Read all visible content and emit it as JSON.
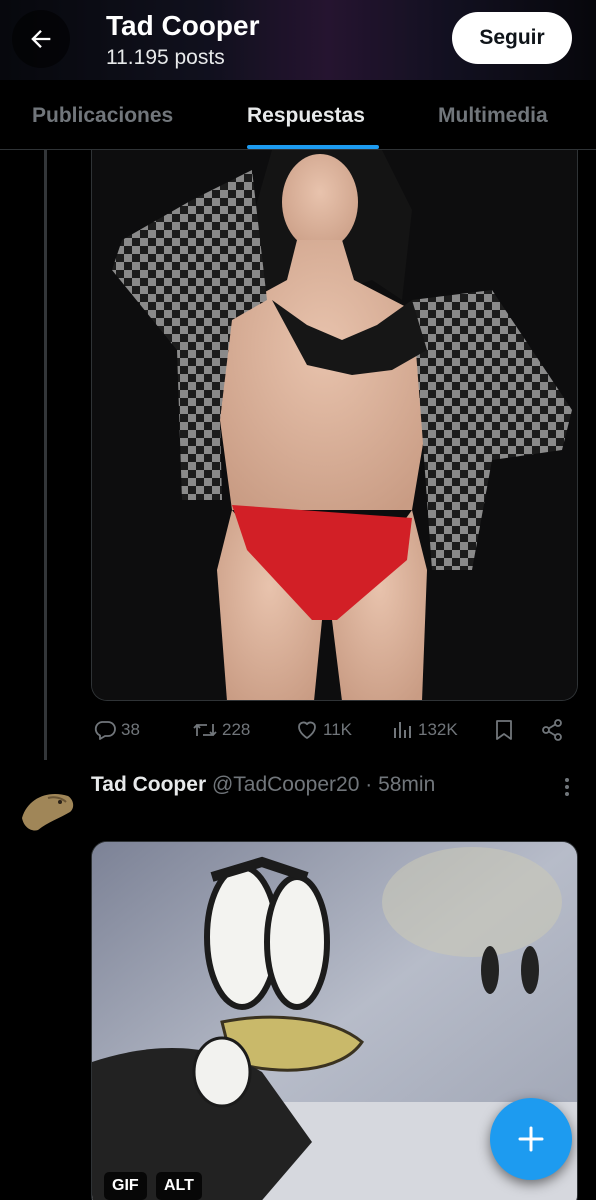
{
  "header": {
    "title": "Tad Cooper",
    "subtitle": "11.195 posts",
    "follow_label": "Seguir",
    "back_icon": "arrow-left-icon"
  },
  "tabs": [
    {
      "label": "Publicaciones",
      "active": false
    },
    {
      "label": "Respuestas",
      "active": true
    },
    {
      "label": "Multimedia",
      "active": false
    }
  ],
  "colors": {
    "accent": "#1d9bf0",
    "background": "#000000",
    "muted_text": "#71767b",
    "primary_text": "#e7e9ea"
  },
  "post1": {
    "media_alt": "photo",
    "actions": {
      "replies": "38",
      "reposts": "228",
      "likes": "11K",
      "views": "132K",
      "icons": [
        "reply-icon",
        "repost-icon",
        "like-icon",
        "views-icon",
        "bookmark-icon",
        "share-icon"
      ]
    }
  },
  "post2": {
    "name": "Tad Cooper",
    "handle": "@TadCooper20",
    "separator": "·",
    "time": "58min",
    "badges": {
      "gif": "GIF",
      "alt": "ALT"
    }
  },
  "fab": {
    "icon": "plus-icon"
  }
}
